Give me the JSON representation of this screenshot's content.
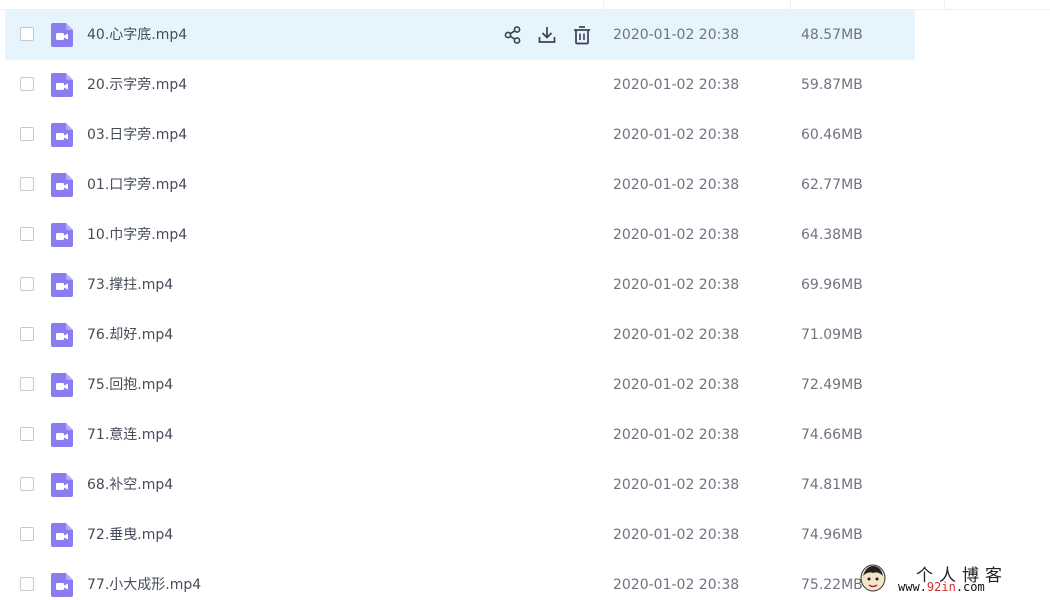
{
  "colors": {
    "hover_row_bg": "#e6f4fd",
    "video_icon": "#8a7df0",
    "text_primary": "#454d5a",
    "text_secondary": "#6e7580",
    "watermark_accent": "#d32f2f"
  },
  "row_actions": [
    {
      "icon": "share-icon"
    },
    {
      "icon": "download-icon"
    },
    {
      "icon": "delete-icon"
    }
  ],
  "files": [
    {
      "name": "40.心字底.mp4",
      "modified": "2020-01-02 20:38",
      "size": "48.57MB",
      "hovered": true
    },
    {
      "name": "20.示字旁.mp4",
      "modified": "2020-01-02 20:38",
      "size": "59.87MB"
    },
    {
      "name": "03.日字旁.mp4",
      "modified": "2020-01-02 20:38",
      "size": "60.46MB"
    },
    {
      "name": "01.口字旁.mp4",
      "modified": "2020-01-02 20:38",
      "size": "62.77MB"
    },
    {
      "name": "10.巾字旁.mp4",
      "modified": "2020-01-02 20:38",
      "size": "64.38MB"
    },
    {
      "name": "73.撑拄.mp4",
      "modified": "2020-01-02 20:38",
      "size": "69.96MB"
    },
    {
      "name": "76.却好.mp4",
      "modified": "2020-01-02 20:38",
      "size": "71.09MB"
    },
    {
      "name": "75.回抱.mp4",
      "modified": "2020-01-02 20:38",
      "size": "72.49MB"
    },
    {
      "name": "71.意连.mp4",
      "modified": "2020-01-02 20:38",
      "size": "74.66MB"
    },
    {
      "name": "68.补空.mp4",
      "modified": "2020-01-02 20:38",
      "size": "74.81MB"
    },
    {
      "name": "72.垂曳.mp4",
      "modified": "2020-01-02 20:38",
      "size": "74.96MB"
    },
    {
      "name": "77.小大成形.mp4",
      "modified": "2020-01-02 20:38",
      "size": "75.22MB"
    }
  ],
  "watermark": {
    "title": "个人博客",
    "url_prefix": "www.",
    "url_accent": "92in",
    "url_suffix": ".com"
  }
}
